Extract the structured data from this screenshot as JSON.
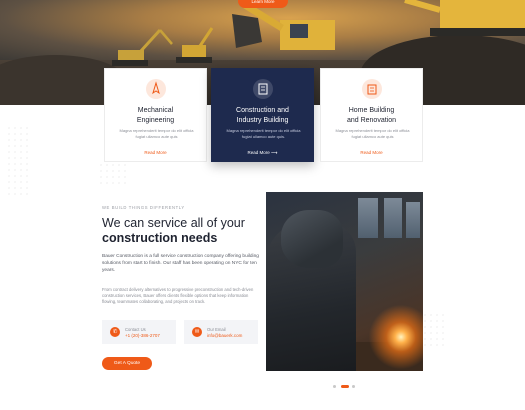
{
  "hero": {
    "button_label": "Learn More"
  },
  "cards": [
    {
      "title_line1": "Mechanical",
      "title_line2": "Engineering",
      "description": "Magna reprehenderit tempor do elit officia fugiat ullamco aute quis",
      "link": "Read More"
    },
    {
      "title_line1": "Construction and",
      "title_line2": "Industry Building",
      "description": "Magna reprehenderit tempor do elit officia fugiat ullamco aute quis.",
      "link": "Read More"
    },
    {
      "title_line1": "Home Building",
      "title_line2": "and Renovation",
      "description": "Magna reprehenderit tempor do elit officia fugiat ullamco aute quis",
      "link": "Read More"
    }
  ],
  "about": {
    "eyebrow": "WE BUILD THINGS DIFFERENTLY",
    "heading_line1": "We can service all of your",
    "heading_line2": "construction needs",
    "paragraph1": "Bauer Construction is a full service construction company offering building solutions from start to finish. Our staff has been operating on NYC for ten years.",
    "paragraph2": "From contract delivery alternatives to progressive preconstruction and tech-driven construction services, Bauer offers clients flexible options that keep information flowing, teammates collaborating, and projects on track.",
    "contact_us_label": "Contact Us",
    "contact_us_value": "+1 (20)-386-2707",
    "email_label": "Our Email",
    "email_value": "info@bauerk.com",
    "quote_button": "Get A Quote"
  },
  "colors": {
    "accent": "#ef5a18",
    "navy": "#1e2a4e"
  }
}
